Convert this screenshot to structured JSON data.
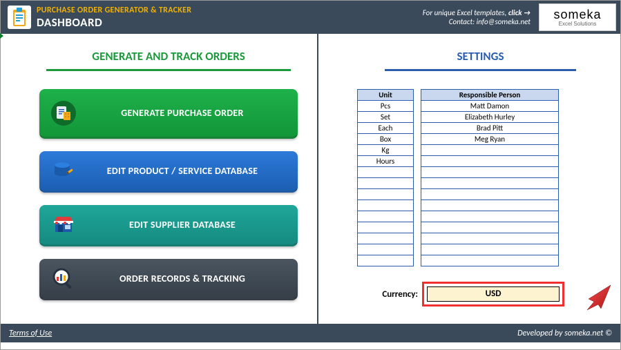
{
  "header": {
    "title": "PURCHASE ORDER GENERATOR & TRACKER",
    "subtitle": "DASHBOARD",
    "cta_prefix": "For unique Excel templates, ",
    "cta_bold": "click →",
    "contact": "Contact: info@someka.net",
    "logo_top": "someka",
    "logo_sub": "Excel Solutions"
  },
  "left": {
    "title": "GENERATE AND TRACK ORDERS",
    "buttons": {
      "generate": "GENERATE PURCHASE ORDER",
      "edit_product": "EDIT PRODUCT / SERVICE DATABASE",
      "edit_supplier": "EDIT SUPPLIER DATABASE",
      "order_records": "ORDER RECORDS & TRACKING"
    }
  },
  "right": {
    "title": "SETTINGS",
    "unit_header": "Unit",
    "units": [
      "Pcs",
      "Set",
      "Each",
      "Box",
      "Kg",
      "Hours",
      "",
      "",
      "",
      "",
      "",
      "",
      "",
      "",
      ""
    ],
    "person_header": "Responsible Person",
    "persons": [
      "Matt Damon",
      "Elizabeth Hurley",
      "Brad Pitt",
      "Meg Ryan",
      "",
      "",
      "",
      "",
      "",
      "",
      "",
      "",
      "",
      "",
      ""
    ],
    "currency_label": "Currency:",
    "currency_value": "USD"
  },
  "footer": {
    "terms": "Terms of Use",
    "developed": "Developed by someka.net ©"
  }
}
